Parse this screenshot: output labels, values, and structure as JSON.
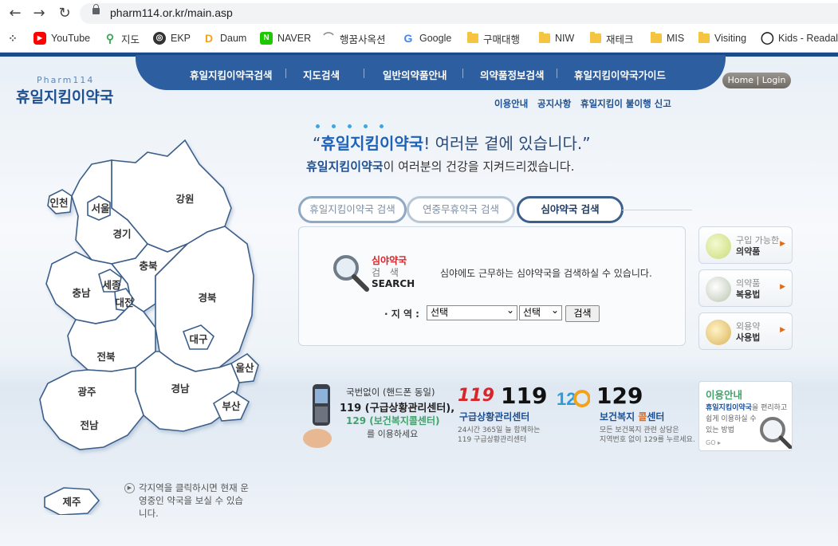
{
  "browser": {
    "url": "pharm114.or.kr/main.asp",
    "bookmarks": [
      {
        "label": "YouTube",
        "icon": "youtube-icon"
      },
      {
        "label": "지도",
        "icon": "map-pin-icon"
      },
      {
        "label": "EKP",
        "icon": "globe-icon"
      },
      {
        "label": "Daum",
        "icon": "daum-icon"
      },
      {
        "label": "NAVER",
        "icon": "naver-icon"
      },
      {
        "label": "행꿈사옥션",
        "icon": "site-icon"
      },
      {
        "label": "Google",
        "icon": "google-icon"
      },
      {
        "label": "구매대행",
        "icon": "folder-icon"
      },
      {
        "label": "NIW",
        "icon": "folder-icon"
      },
      {
        "label": "재테크",
        "icon": "folder-icon"
      },
      {
        "label": "MIS",
        "icon": "folder-icon"
      },
      {
        "label": "Visiting",
        "icon": "folder-icon"
      },
      {
        "label": "Kids - Readalo",
        "icon": "circle-icon"
      }
    ]
  },
  "header": {
    "logo_sub": "Pharm114",
    "logo_main": "휴일지킴이약국",
    "nav": [
      "휴일지킴이약국검색",
      "지도검색",
      "일반의약품안내",
      "의약품정보검색",
      "휴일지킴이약국가이드"
    ],
    "home_login": "Home | Login",
    "sublinks": [
      "이용안내",
      "공지사항",
      "휴일지킴이 불이행 신고"
    ]
  },
  "slogan": {
    "line1_quote_open": "“",
    "line1_strong": "휴일지킴이약국",
    "line1_rest": "! 여러분 곁에 있습니다.”",
    "line2_strong": "휴일지킴이약국",
    "line2_rest": "이 여러분의 건강을 지켜드리겠습니다."
  },
  "map": {
    "regions": [
      "인천",
      "서울",
      "경기",
      "강원",
      "충북",
      "충남",
      "세종",
      "대전",
      "경북",
      "대구",
      "전북",
      "울산",
      "경남",
      "부산",
      "광주",
      "전남",
      "제주"
    ],
    "hint": "각지역을 클릭하시면 현재 운영중인 약국을 보실 수 있습니다."
  },
  "tabs": [
    "휴일지킴이약국 검색",
    "연중무휴약국 검색",
    "심야약국 검색"
  ],
  "search": {
    "label_line1": "심야약국",
    "label_line2": "검 색",
    "label_line3": "SEARCH",
    "description": "심야에도 근무하는 심야약국을 검색하실 수 있습니다.",
    "region_label": "· 지 역 :",
    "select1_value": "선택",
    "select2_value": "선택",
    "button": "검색"
  },
  "side_menu": [
    {
      "line1": "구입 가능한",
      "line2": "의약품",
      "icon": "pill-icon"
    },
    {
      "line1": "의약품",
      "line2": "복용법",
      "icon": "mortar-icon"
    },
    {
      "line1": "외용약",
      "line2": "사용법",
      "icon": "ointment-icon"
    }
  ],
  "emergency": {
    "phone_line1": "국번없이 (핸드폰 동일)",
    "phone_line2": "119 (구급상황관리센터),",
    "phone_line3": "129 (보건복지콜센터)",
    "phone_line4": "를 이용하세요",
    "c119_logo": "119",
    "c119_number": "119",
    "c119_title": "구급상황관리센터",
    "c119_desc1": "24시간 365일 늘 함께하는",
    "c119_desc2": "119 구급상황관리센터",
    "c129_number": "129",
    "c129_title_pre": "보건복지 ",
    "c129_title_hl": "콜",
    "c129_title_post": "센터",
    "c129_desc1": "모든 보건복지 관련 상담은",
    "c129_desc2": "지역번호 없이 129를 누르세요."
  },
  "info_box": {
    "title": "이용안내",
    "text_strong": "휴일지킴이약국",
    "text1": "을 편리하고",
    "text2": "쉽게 이용하실 수",
    "text3": "있는 방법",
    "go": "GO ▸"
  },
  "colors": {
    "brand_blue": "#2d5e9f",
    "accent_red": "#d9252a",
    "accent_orange": "#e06b1b",
    "green_129": "#3fa36a"
  }
}
